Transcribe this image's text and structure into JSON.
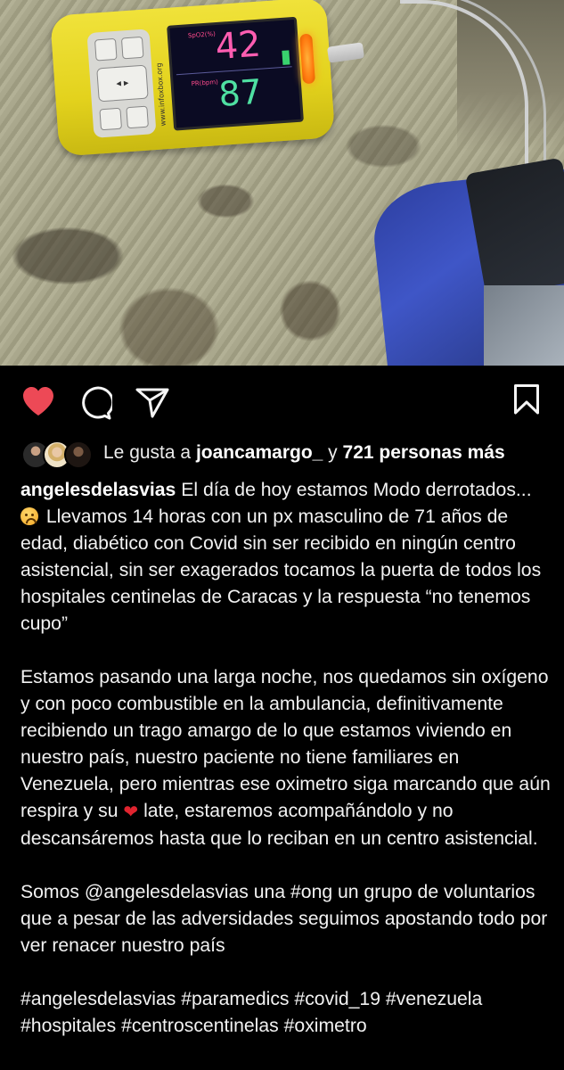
{
  "photo": {
    "oximeter": {
      "spo2_label": "SpO2(%)",
      "spo2_value": "42",
      "pr_label": "PR(bpm)",
      "pr_value": "87",
      "brand_url": "www.infoxbox.org"
    }
  },
  "actions": {
    "like_state": "liked",
    "colors": {
      "heart": "#ed4956",
      "icons": "#f5f5f5"
    }
  },
  "likes": {
    "prefix": "Le gusta a",
    "user": "joancamargo_",
    "connector": "y",
    "others": "721 personas más"
  },
  "caption": {
    "username": "angelesdelasvias",
    "line1": "El día de hoy estamos Modo derrotados...",
    "line2": "Llevamos 14 horas con un px masculino de 71 años de edad, diabético con Covid sin ser recibido en ningún centro asistencial, sin ser exagerados tocamos la puerta de todos los hospitales centinelas de Caracas y la respuesta “no tenemos cupo”",
    "para2_a": "Estamos pasando una larga noche, nos quedamos sin oxígeno y con poco combustible en la ambulancia, definitivamente recibiendo un trago amargo de lo que estamos viviendo en nuestro país, nuestro paciente no tiene familiares en Venezuela, pero mientras ese oximetro siga marcando que aún respira y su",
    "para2_b": "late, estaremos acompañándolo y no descansáremos hasta que lo reciban en un centro asistencial.",
    "para3": " Somos @angelesdelasvias una #ong un grupo de voluntarios que a pesar de las adversidades seguimos apostando todo por ver renacer nuestro país",
    "hashtags": "#angelesdelasvias #paramedics #covid_19 #venezuela #hospitales #centroscentinelas #oximetro"
  }
}
